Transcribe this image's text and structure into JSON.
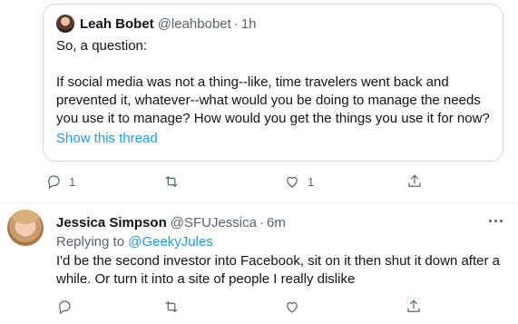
{
  "quoted_tweet": {
    "author_name": "Leah Bobet",
    "author_handle": "@leahbobet",
    "separator": "·",
    "time": "1h",
    "lines": [
      "So, a question:",
      "",
      "If social media was not a thing--like, time travelers went back and",
      "prevented it, whatever--what would you be doing to manage the needs",
      "you use it to manage? How would you get the things you use it for now?"
    ],
    "show_thread_label": "Show this thread"
  },
  "tweet_actions": {
    "reply_count": "1",
    "retweet_count": "",
    "like_count": "1",
    "reply_icon": "reply-icon",
    "retweet_icon": "retweet-icon",
    "like_icon": "heart-icon",
    "share_icon": "share-icon"
  },
  "reply_tweet": {
    "author_name": "Jessica Simpson",
    "author_handle": "@SFUJessica",
    "separator": "·",
    "time": "6m",
    "replying_prefix": "Replying to ",
    "replying_to": "@GeekyJules",
    "text": "I'd be the second investor into Facebook, sit on it then shut it down after a while. Or turn it into a site of people I really dislike"
  },
  "colors": {
    "link": "#1d9bf0",
    "secondary_text": "#536471",
    "border": "#cfd9de"
  }
}
